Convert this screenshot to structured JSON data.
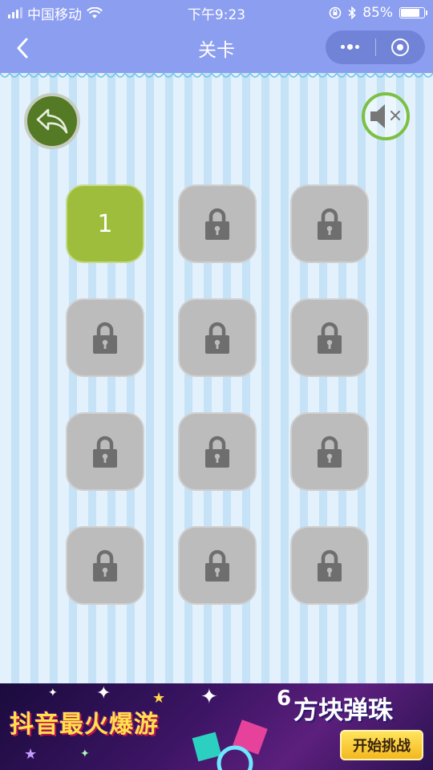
{
  "status_bar": {
    "carrier": "中国移动",
    "time": "下午9:23",
    "battery_text": "85%",
    "battery_level": 0.85,
    "icons": [
      "signal-icon",
      "wifi-icon",
      "orientation-lock-icon",
      "bluetooth-icon",
      "battery-icon"
    ]
  },
  "nav": {
    "title": "关卡",
    "back_icon": "chevron-left-icon",
    "menu_icon": "more-dots-icon",
    "close_icon": "target-circle-icon"
  },
  "game": {
    "back_icon": "reply-arrow-icon",
    "sound_icon": "speaker-muted-icon",
    "levels": [
      {
        "label": "1",
        "locked": false
      },
      {
        "label": "",
        "locked": true
      },
      {
        "label": "",
        "locked": true
      },
      {
        "label": "",
        "locked": true
      },
      {
        "label": "",
        "locked": true
      },
      {
        "label": "",
        "locked": true
      },
      {
        "label": "",
        "locked": true
      },
      {
        "label": "",
        "locked": true
      },
      {
        "label": "",
        "locked": true
      },
      {
        "label": "",
        "locked": true
      },
      {
        "label": "",
        "locked": true
      },
      {
        "label": "",
        "locked": true
      }
    ]
  },
  "ad": {
    "left_text": "抖音最火爆游",
    "number": "6",
    "title": "方块弹珠",
    "cta": "开始挑战"
  },
  "colors": {
    "bar": "#8c9ef0",
    "capsule": "#7183d7",
    "unlocked_tile": "#9fbd3c",
    "locked_tile": "#bcbcbc",
    "back_button": "#557a25",
    "mute_ring": "#7cc043"
  }
}
